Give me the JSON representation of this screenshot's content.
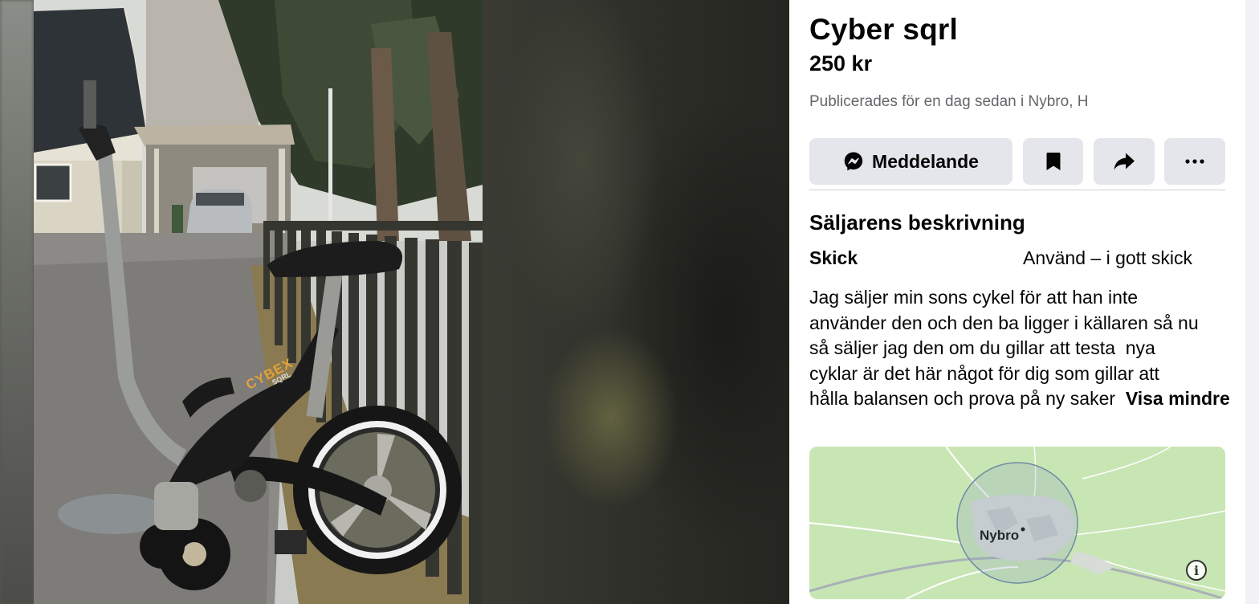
{
  "listing": {
    "title": "Cyber sqrl",
    "price": "250 kr",
    "posted": "Publicerades för en dag sedan i Nybro, H"
  },
  "actions": {
    "message_label": "Meddelande",
    "message_icon": "messenger-icon",
    "save_icon": "bookmark-icon",
    "share_icon": "share-arrow-icon",
    "more_icon": "more-dots-icon"
  },
  "description": {
    "heading": "Säljarens beskrivning",
    "condition_label": "Skick",
    "condition_value": "Använd – i gott skick",
    "lines": [
      "Jag säljer min sons cykel för att han inte",
      "använder den och den ba ligger i källaren så nu",
      "så säljer jag den om du gillar att testa  nya",
      "cyklar är det här något för dig som gillar att",
      "hålla balansen och prova på ny saker  "
    ],
    "show_less": "Visa mindre"
  },
  "map": {
    "place_label": "Nybro",
    "info_icon": "info-icon"
  },
  "photo": {
    "bike_brand": "CYBEX",
    "bike_model": "SQRL"
  },
  "colors": {
    "button_bg": "#e4e6eb",
    "text_primary": "#050505",
    "text_secondary": "#65676b",
    "map_green": "#c8e6b4"
  }
}
